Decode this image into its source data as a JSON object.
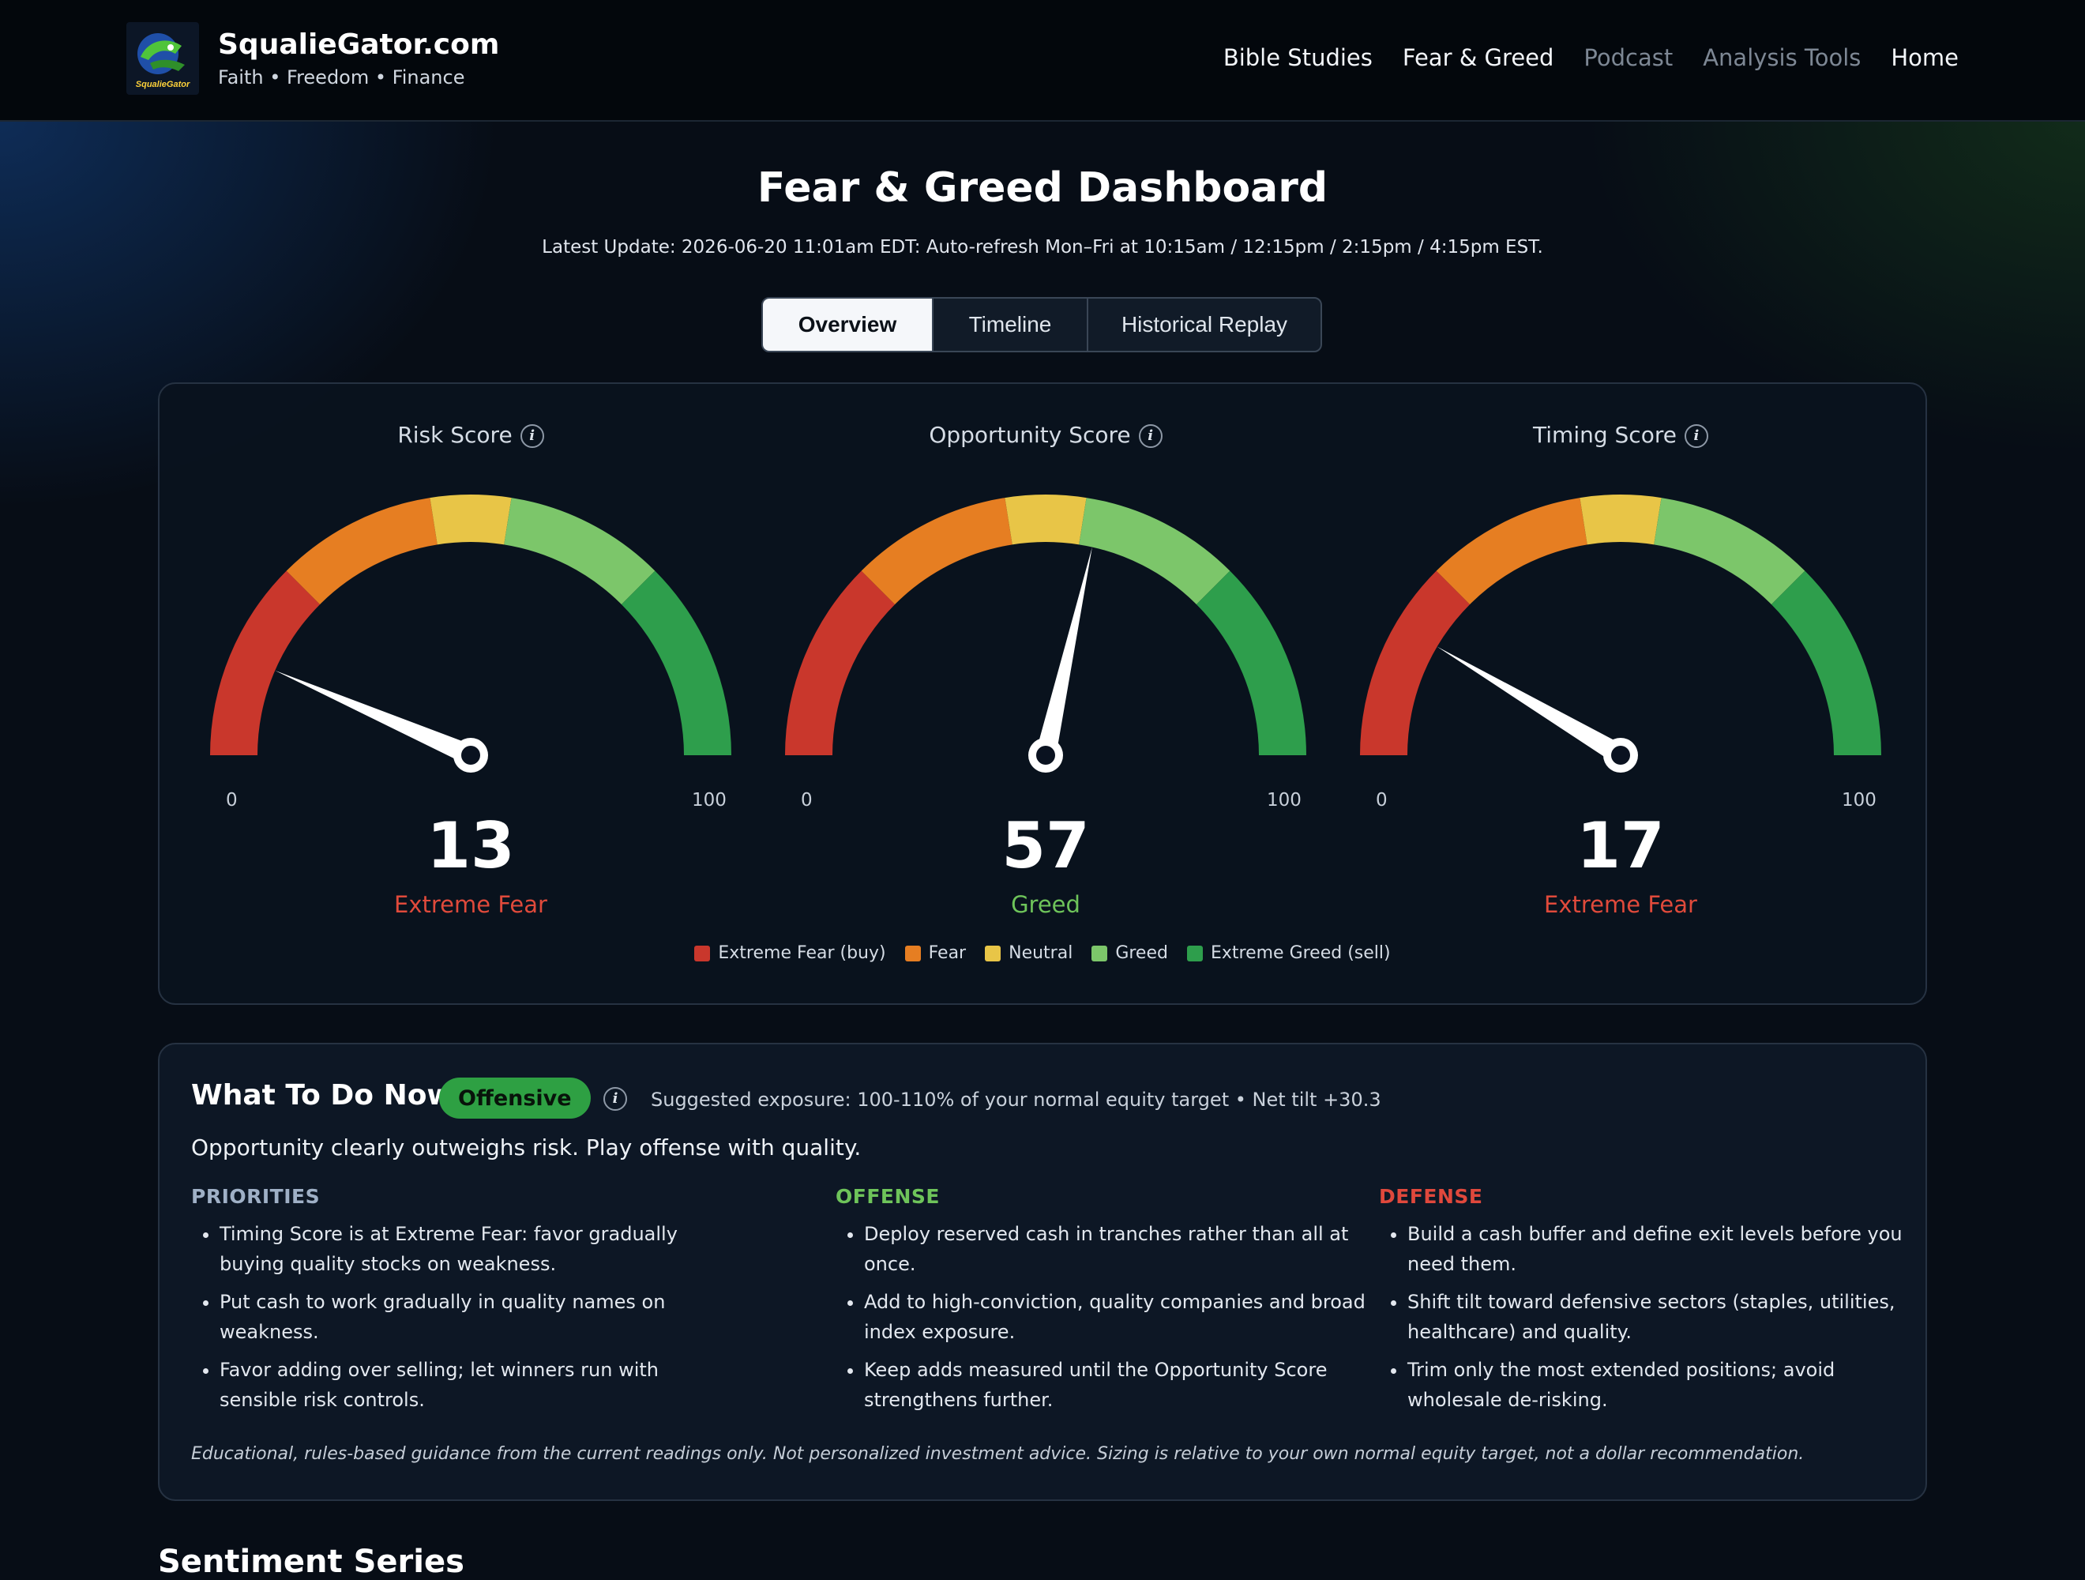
{
  "header": {
    "brand_name": "SqualieGator.com",
    "tagline": "Faith • Freedom • Finance",
    "logo_text": "SqualieGator",
    "nav": [
      {
        "label": "Bible Studies",
        "muted": false
      },
      {
        "label": "Fear & Greed",
        "muted": false
      },
      {
        "label": "Podcast",
        "muted": true
      },
      {
        "label": "Analysis Tools",
        "muted": true
      },
      {
        "label": "Home",
        "muted": false
      }
    ]
  },
  "page": {
    "title": "Fear & Greed Dashboard",
    "update_line": "Latest Update: 2026-06-20 11:01am EDT: Auto-refresh Mon–Fri at 10:15am / 12:15pm / 2:15pm / 4:15pm EST."
  },
  "tabs": [
    {
      "label": "Overview",
      "active": true
    },
    {
      "label": "Timeline",
      "active": false
    },
    {
      "label": "Historical Replay",
      "active": false
    }
  ],
  "gauges": [
    {
      "title": "Risk Score",
      "value": 13,
      "display": "13",
      "label": "Extreme Fear",
      "label_color": "#e04a3b",
      "min": "0",
      "max": "100"
    },
    {
      "title": "Opportunity Score",
      "value": 57,
      "display": "57",
      "label": "Greed",
      "label_color": "#6ec45a",
      "min": "0",
      "max": "100"
    },
    {
      "title": "Timing Score",
      "value": 17,
      "display": "17",
      "label": "Extreme Fear",
      "label_color": "#e04a3b",
      "min": "0",
      "max": "100"
    }
  ],
  "zones": [
    {
      "from": 0,
      "to": 25,
      "color": "#c9372c"
    },
    {
      "from": 25,
      "to": 45,
      "color": "#e67e22"
    },
    {
      "from": 45,
      "to": 55,
      "color": "#e8c547"
    },
    {
      "from": 55,
      "to": 75,
      "color": "#7cc66a"
    },
    {
      "from": 75,
      "to": 100,
      "color": "#2e9e4c"
    }
  ],
  "legend": [
    {
      "label": "Extreme Fear (buy)",
      "color": "#c9372c"
    },
    {
      "label": "Fear",
      "color": "#e67e22"
    },
    {
      "label": "Neutral",
      "color": "#e8c547"
    },
    {
      "label": "Greed",
      "color": "#7cc66a"
    },
    {
      "label": "Extreme Greed (sell)",
      "color": "#2e9e4c"
    }
  ],
  "action": {
    "title": "What To Do Now",
    "badge": "Offensive",
    "exposure": "Suggested exposure: 100-110% of your normal equity target • Net tilt +30.3",
    "summary": "Opportunity clearly outweighs risk. Play offense with quality.",
    "columns": [
      {
        "heading": "PRIORITIES",
        "color": "#9fb0c6",
        "items": [
          "Timing Score is at Extreme Fear: favor gradually buying quality stocks on weakness.",
          "Put cash to work gradually in quality names on weakness.",
          "Favor adding over selling; let winners run with sensible risk controls."
        ]
      },
      {
        "heading": "OFFENSE",
        "color": "#6ec45a",
        "items": [
          "Deploy reserved cash in tranches rather than all at once.",
          "Add to high-conviction, quality companies and broad index exposure.",
          "Keep adds measured until the Opportunity Score strengthens further."
        ]
      },
      {
        "heading": "DEFENSE",
        "color": "#e0483c",
        "items": [
          "Build a cash buffer and define exit levels before you need them.",
          "Shift tilt toward defensive sectors (staples, utilities, healthcare) and quality.",
          "Trim only the most extended positions; avoid wholesale de-risking."
        ]
      }
    ],
    "disclaimer": "Educational, rules-based guidance from the current readings only. Not personalized investment advice. Sizing is relative to your own normal equity target, not a dollar recommendation."
  },
  "next_section": {
    "title": "Sentiment Series"
  }
}
